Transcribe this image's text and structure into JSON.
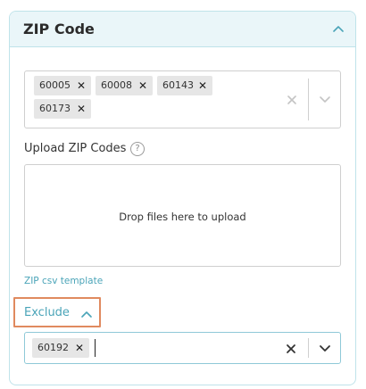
{
  "panel": {
    "title": "ZIP Code"
  },
  "zip_select": {
    "tags": [
      "60005",
      "60008",
      "60143",
      "60173"
    ]
  },
  "upload": {
    "label": "Upload ZIP Codes",
    "help_glyph": "?",
    "dropzone_text": "Drop files here to upload"
  },
  "csv_link": "ZIP csv template",
  "exclude": {
    "label": "Exclude",
    "tags": [
      "60192"
    ]
  },
  "colors": {
    "accent": "#4aa4b8",
    "header_bg": "#eaf6f9",
    "highlight": "#e08a5f",
    "tag_bg": "#e6e6e6"
  },
  "icons": {
    "collapse": "chevron-up-icon",
    "tag_remove": "close-icon",
    "clear": "close-icon",
    "dropdown": "chevron-down-icon",
    "help": "question-circle-icon"
  }
}
